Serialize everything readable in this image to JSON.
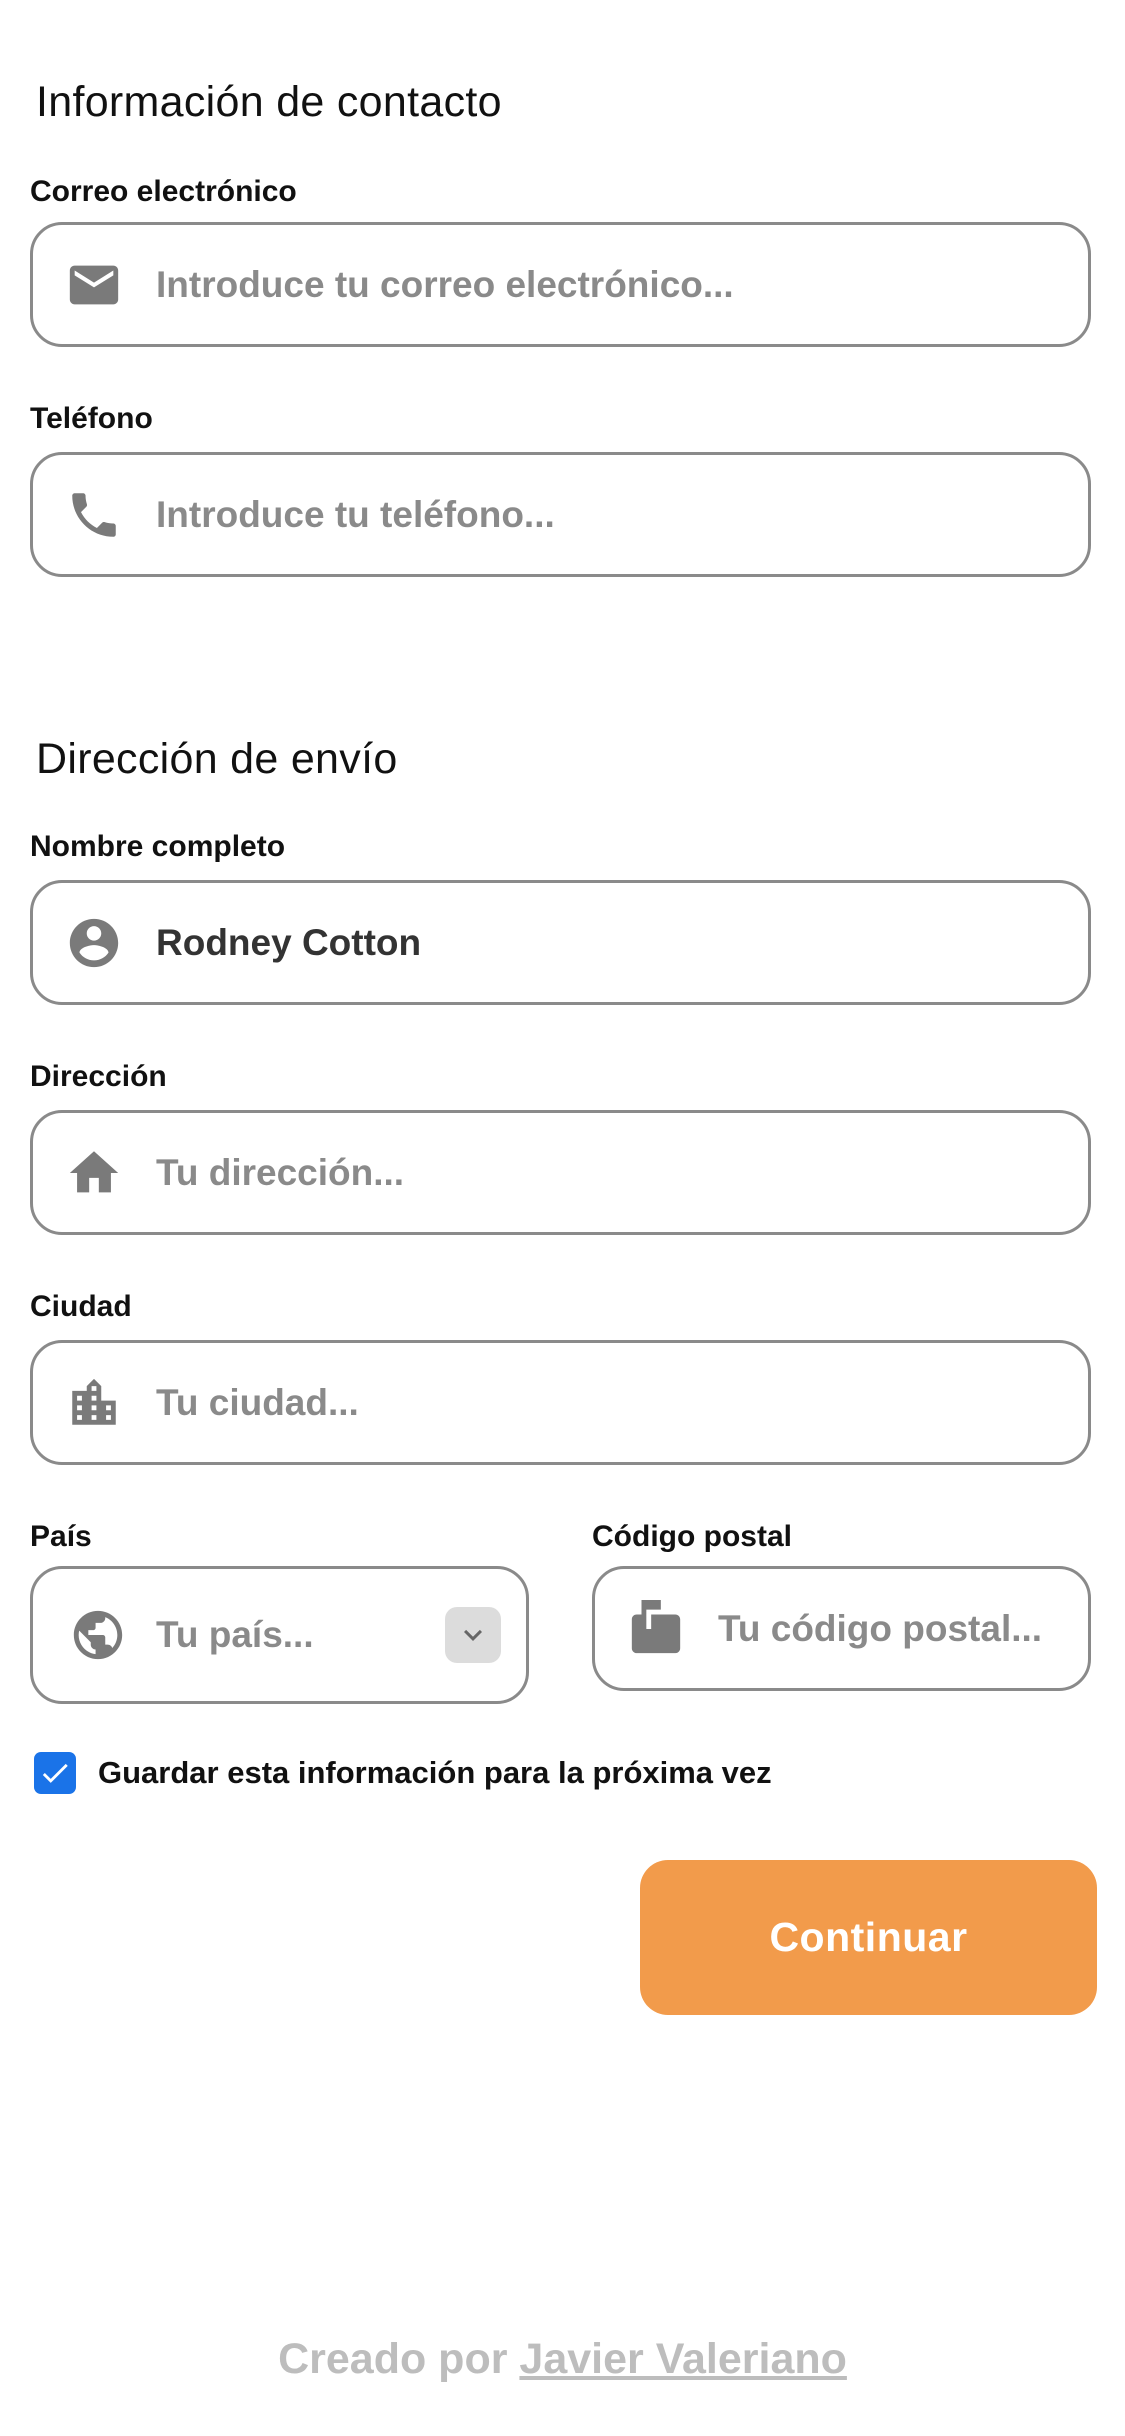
{
  "contact": {
    "title": "Información de contacto",
    "email": {
      "label": "Correo electrónico",
      "value": "",
      "placeholder": "Introduce tu correo electrónico...",
      "icon": "mail-icon"
    },
    "phone": {
      "label": "Teléfono",
      "value": "",
      "placeholder": "Introduce tu teléfono...",
      "icon": "phone-icon"
    }
  },
  "shipping": {
    "title": "Dirección de envío",
    "full_name": {
      "label": "Nombre completo",
      "value": "Rodney Cotton",
      "placeholder": "",
      "icon": "account-circle-icon"
    },
    "address": {
      "label": "Dirección",
      "value": "",
      "placeholder": "Tu dirección...",
      "icon": "home-icon"
    },
    "city": {
      "label": "Ciudad",
      "value": "",
      "placeholder": "Tu ciudad...",
      "icon": "city-icon"
    },
    "country": {
      "label": "País",
      "selected": "Tu país...",
      "icon": "globe-icon"
    },
    "postal_code": {
      "label": "Código postal",
      "value": "",
      "placeholder": "Tu código postal...",
      "icon": "mailbox-icon"
    }
  },
  "save_info": {
    "label": "Guardar esta información para la próxima vez",
    "checked": true
  },
  "continue_button": {
    "label": "Continuar",
    "color": "#f29b4b"
  },
  "footer": {
    "prefix": "Creado por",
    "author": "Javier Valeriano"
  },
  "colors": {
    "accent": "#f29b4b",
    "checkbox": "#1a73e8",
    "border": "#8a8a8a"
  }
}
